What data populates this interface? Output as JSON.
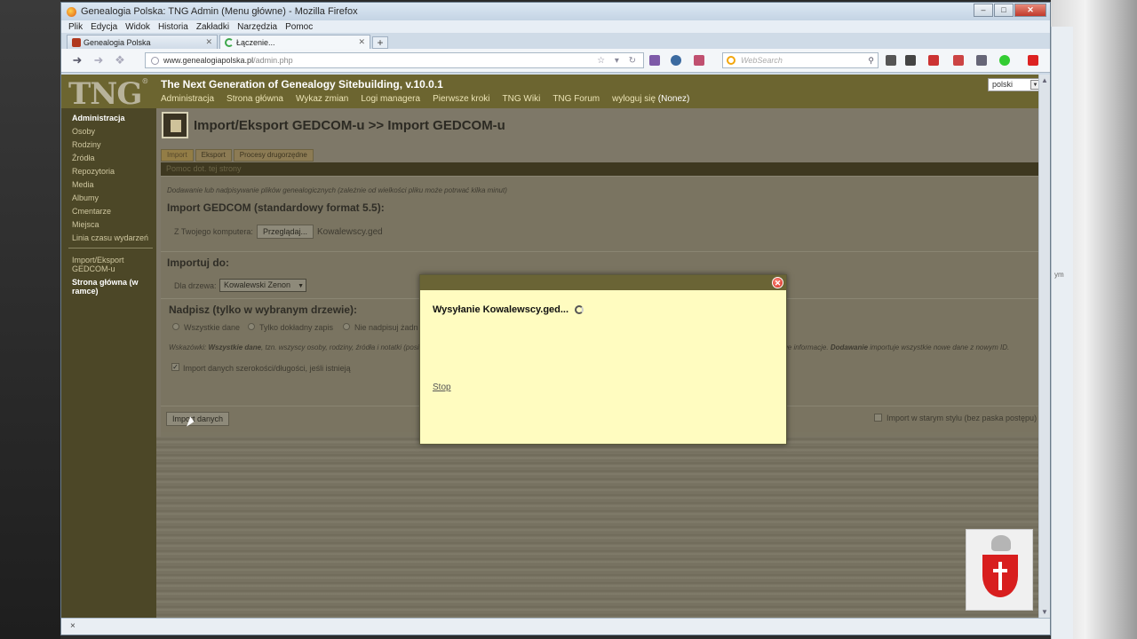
{
  "window": {
    "title": "Genealogia Polska: TNG Admin (Menu główne) - Mozilla Firefox"
  },
  "menubar": [
    "Plik",
    "Edycja",
    "Widok",
    "Historia",
    "Zakładki",
    "Narzędzia",
    "Pomoc"
  ],
  "tabs": [
    {
      "label": "Genealogia Polska",
      "active": false
    },
    {
      "label": "Łączenie...",
      "active": true
    }
  ],
  "address": {
    "host": "www.genealogiapolska.pl",
    "path": "/admin.php"
  },
  "search": {
    "placeholder": "WebSearch"
  },
  "header": {
    "logo": "TNG",
    "logo_mark": "®",
    "title": "The Next Generation of Genealogy Sitebuilding, v.10.0.1",
    "nav": [
      "Administracja",
      "Strona główna",
      "Wykaz zmian",
      "Logi managera",
      "Pierwsze kroki",
      "TNG Wiki",
      "TNG Forum",
      "wyloguj się"
    ],
    "user": "(Nonez)",
    "language": "polski"
  },
  "sidebar": {
    "items": [
      "Administracja",
      "Osoby",
      "Rodziny",
      "Źródła",
      "Repozytoria",
      "Media",
      "Albumy",
      "Cmentarze",
      "Miejsca",
      "Linia czasu wydarzeń"
    ],
    "bottom_items": [
      "Import/Eksport GEDCOM-u",
      "Strona główna (w ramce)"
    ]
  },
  "section": {
    "title": "Import/Eksport GEDCOM-u >> Import GEDCOM-u",
    "subtabs": [
      "Import",
      "Eksport",
      "Procesy drugorzędne"
    ],
    "help": "Pomoc dot. tej strony"
  },
  "form": {
    "intro": "Dodawanie lub nadpisywanie plików genealogicznych (zależnie od wielkości pliku może potrwać kilka minut)",
    "import_heading": "Import GEDCOM (standardowy format 5.5):",
    "from_computer_label": "Z Twojego komputera:",
    "browse_label": "Przeglądaj...",
    "filename": "Kowalewscy.ged",
    "import_to_heading": "Importuj do:",
    "tree_label": "Dla drzewa:",
    "tree_value": "Kowalewski Zenon",
    "overwrite_heading": "Nadpisz (tylko w wybranym drzewie):",
    "radios": [
      "Wszystkie dane",
      "Tylko dokładny zapis",
      "Nie nadpisuj żadn"
    ],
    "hint_prefix": "Wskazówki:",
    "hint_bold": "Wszystkie dane",
    "hint_text": ", tzn. wszyscy osoby, rodziny, źródła i notatki (posiadane",
    "hint_right": "we informacje.",
    "hint_right_bold": "Dodawanie",
    "hint_right_tail": "importuje wszystkie nowe dane z nowym ID.",
    "latlong_label": "Import danych szerokości/długości, jeśli istnieją",
    "import_button": "Import danych",
    "oldstyle_label": "Import w starym stylu (bez paska postępu)"
  },
  "modal": {
    "message": "Wysyłanie Kowalewscy.ged...",
    "stop": "Stop"
  },
  "status": {
    "text": "×"
  },
  "side_fragment": "ym"
}
